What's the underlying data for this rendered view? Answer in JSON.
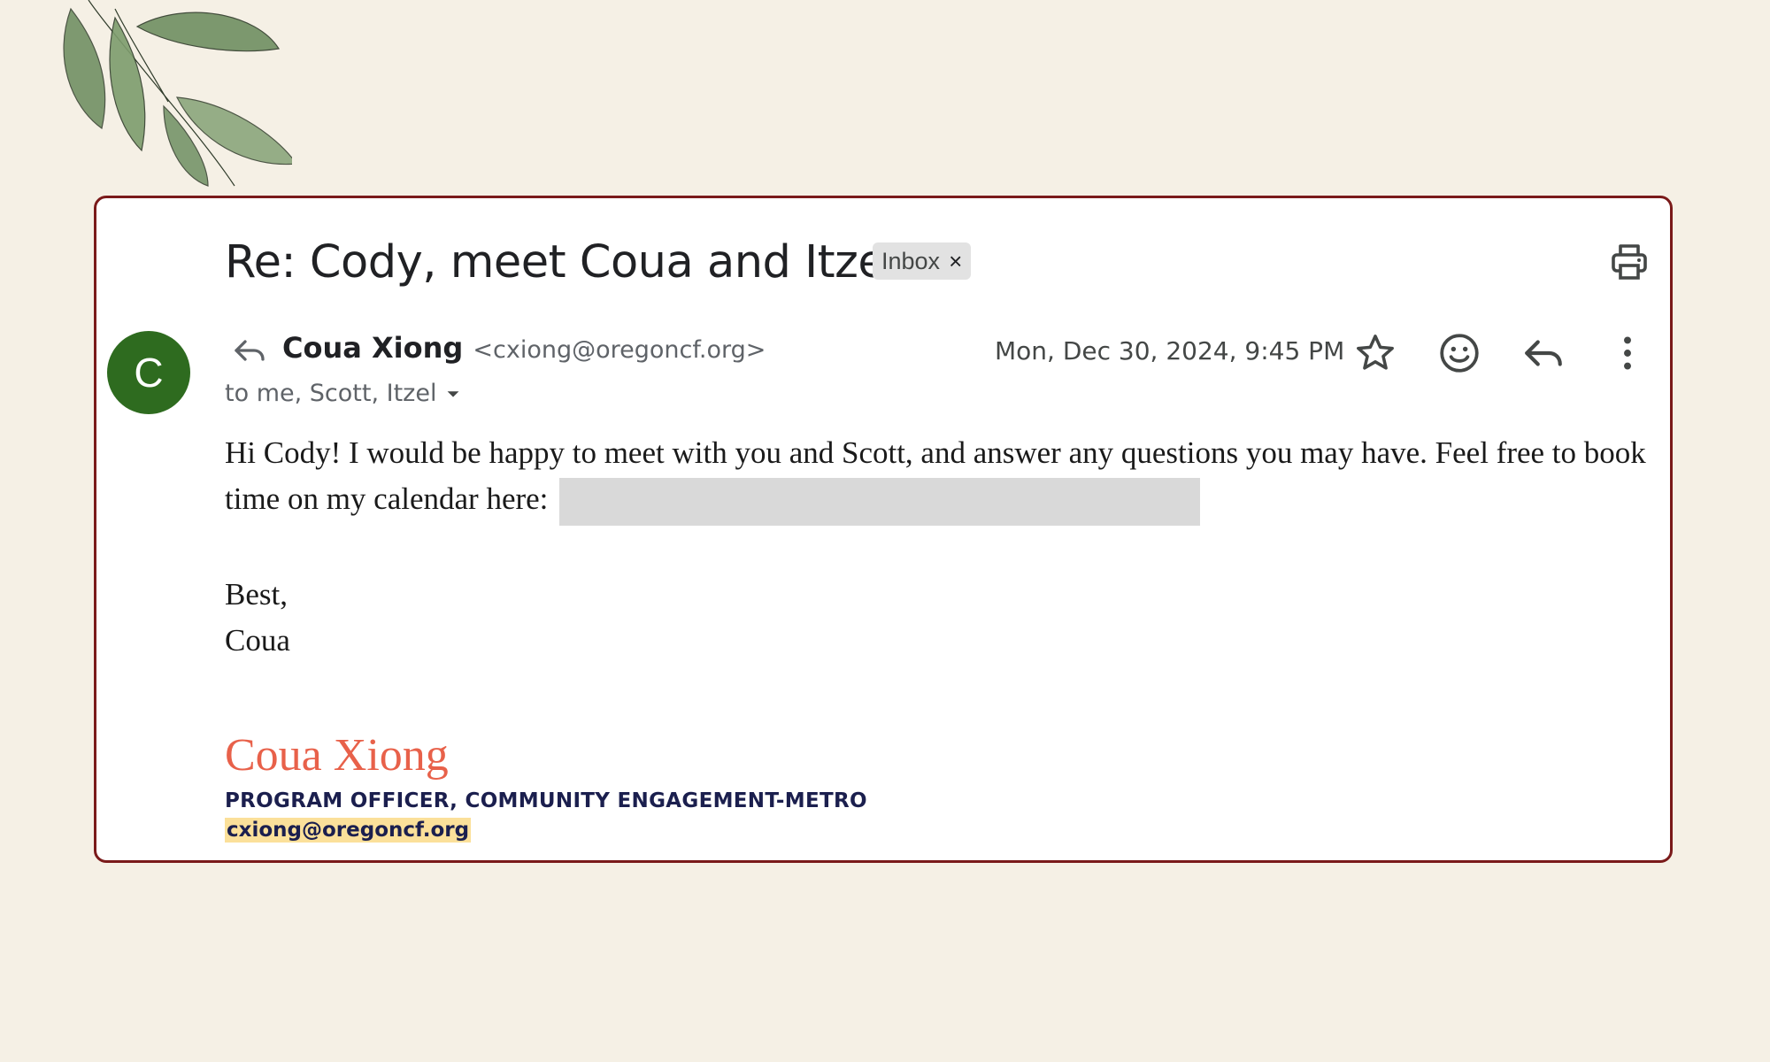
{
  "email": {
    "subject": "Re: Cody, meet Coua and Itzel!",
    "label": "Inbox",
    "label_remove": "×",
    "avatar_initial": "C",
    "sender_name": "Coua Xiong",
    "sender_email": "<cxiong@oregoncf.org>",
    "recipients": "to me, Scott, Itzel",
    "date": "Mon, Dec 30, 2024, 9:45 PM",
    "body_line1": "Hi Cody! I would be happy to meet with you and Scott, and answer any questions you may have. Feel free to book time on my calendar here:",
    "signoff": "Best,",
    "signoff_name": "Coua"
  },
  "signature": {
    "name": "Coua Xiong",
    "title": "PROGRAM OFFICER, COMMUNITY ENGAGEMENT-METRO",
    "email": "cxiong@oregoncf.org"
  },
  "icons": [
    "print-icon",
    "reply-icon",
    "chevron-down-icon",
    "star-icon",
    "emoji-icon",
    "more-vert-icon",
    "leaf-decoration"
  ],
  "colors": {
    "background": "#f5f0e5",
    "card_border": "#7a1a1a",
    "avatar": "#2e6b1f",
    "signature_name": "#e8614a",
    "signature_text": "#1b1f4e",
    "email_highlight": "#fbe09a",
    "redaction": "#d9d9d9"
  }
}
